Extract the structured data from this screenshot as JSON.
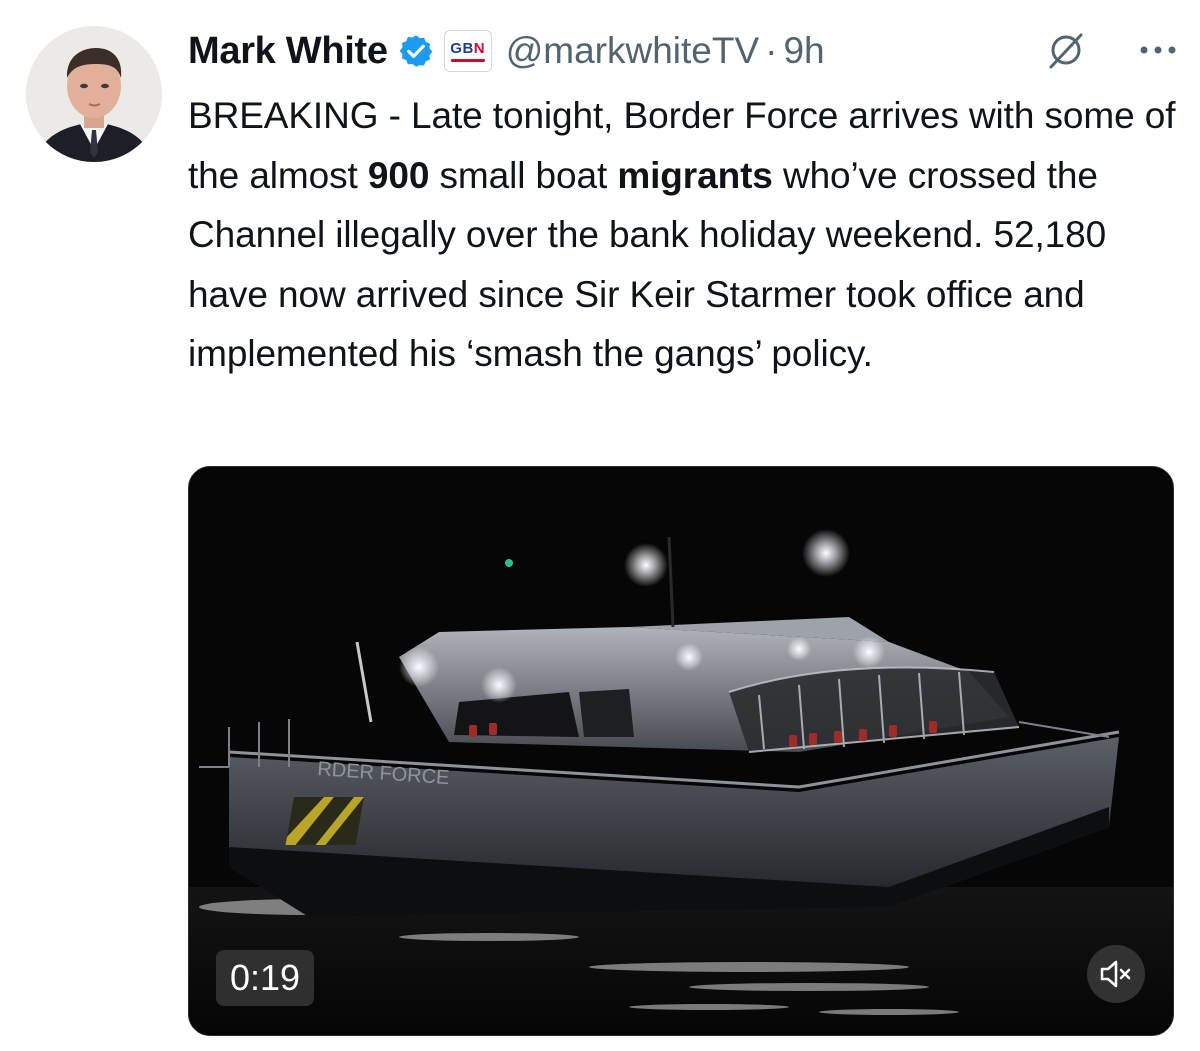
{
  "author": {
    "name": "Mark White",
    "handle": "@markwhiteTV",
    "separator": "·",
    "time": "9h",
    "verified_color": "#1d9bf0",
    "affiliation_badge": {
      "text_left": "GB",
      "text_right": "N",
      "subtext": "BRITAIN'S NEWS CHANNEL"
    }
  },
  "icons": {
    "grok": "grok-icon",
    "more": "more-icon",
    "verified": "verified-badge-icon",
    "mute": "volume-muted-icon"
  },
  "tweet": {
    "t1": "BREAKING - Late tonight, Border Force arrives with some of the almost ",
    "b1": "900",
    "t2": " small boat ",
    "b2": "migrants",
    "t3": " who’ve crossed the Channel illegally over the bank holiday weekend. 52,180 have now arrived since Sir Keir Starmer took office and implemented his ‘smash the gangs’ policy."
  },
  "media": {
    "type": "video",
    "duration": "0:19",
    "vessel_marking": "RDER FORCE",
    "muted": true
  }
}
